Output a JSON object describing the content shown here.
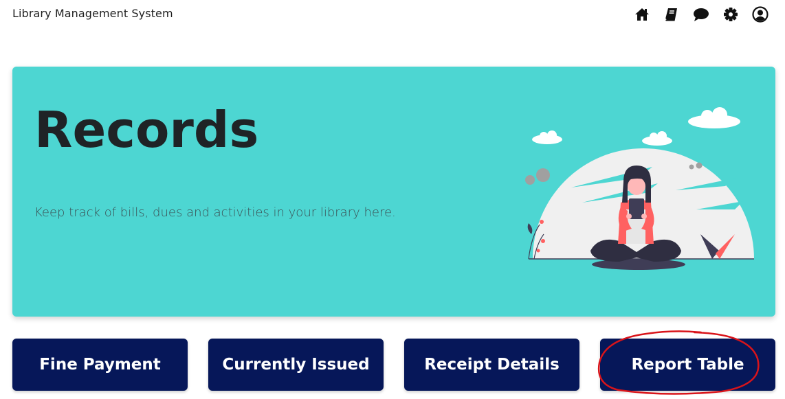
{
  "app": {
    "title": "Library Management System"
  },
  "nav_icons": [
    {
      "name": "home-icon"
    },
    {
      "name": "book-icon"
    },
    {
      "name": "chat-icon"
    },
    {
      "name": "gear-icon"
    },
    {
      "name": "user-circle-icon"
    }
  ],
  "hero": {
    "title": "Records",
    "subtitle": "Keep track of bills, dues and activities in your library here.",
    "background_color": "#4dd6d2"
  },
  "actions": {
    "fine_payment": "Fine Payment",
    "currently_issued": "Currently Issued",
    "receipt_details": "Receipt Details",
    "report_table": "Report Table",
    "button_color": "#061759"
  },
  "annotation": {
    "highlight_color": "#d9141a",
    "highlighted": "Report Table"
  }
}
